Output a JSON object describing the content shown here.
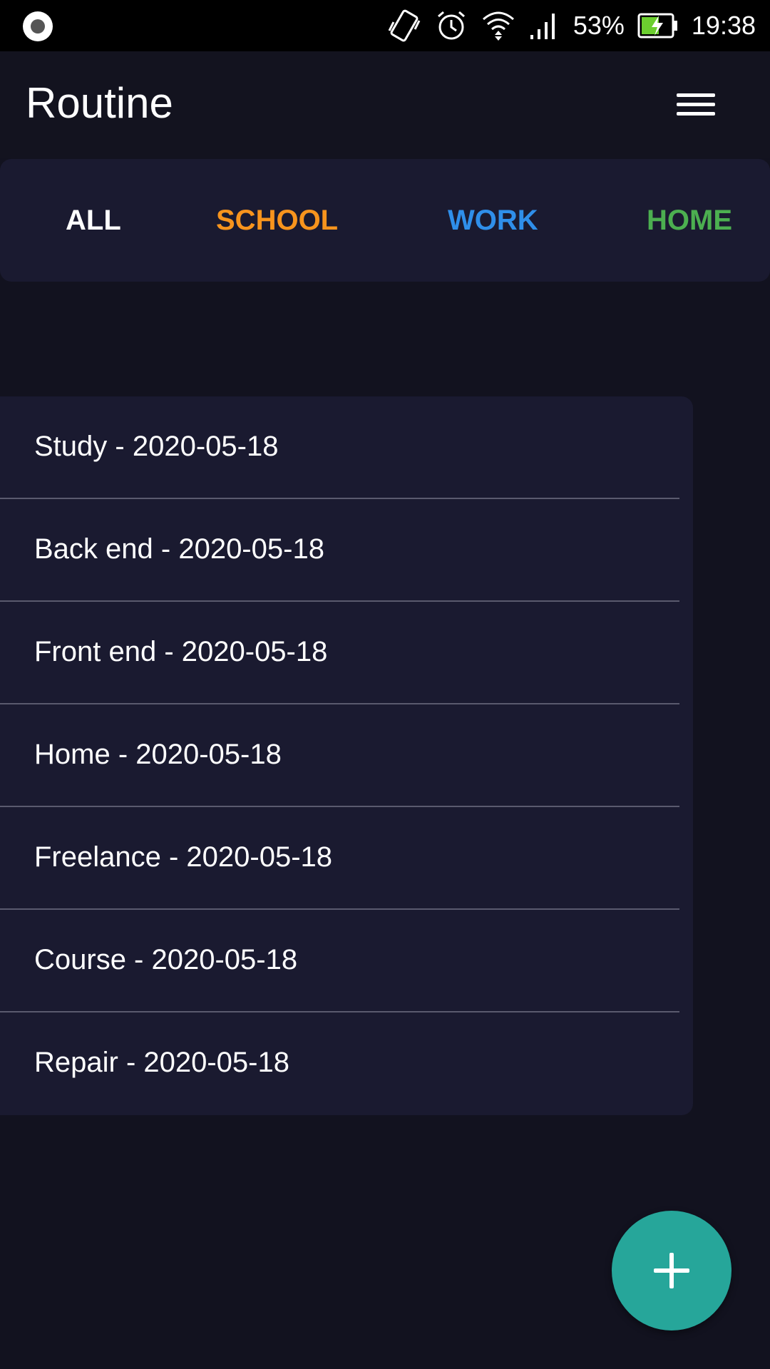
{
  "status_bar": {
    "icons": [
      "vibrate-icon",
      "alarm-icon",
      "wifi-icon",
      "signal-icon",
      "battery-charging-icon"
    ],
    "battery_percent": "53%",
    "time": "19:38"
  },
  "app_bar": {
    "title": "Routine",
    "menu_icon": "hamburger-menu-icon"
  },
  "tabs": [
    {
      "label": "ALL",
      "color": "#ffffff"
    },
    {
      "label": "SCHOOL",
      "color": "#f7941d"
    },
    {
      "label": "WORK",
      "color": "#2f8fea"
    },
    {
      "label": "HOME",
      "color": "#4caf50"
    }
  ],
  "routines": [
    {
      "label": "Study - 2020-05-18"
    },
    {
      "label": "Back end - 2020-05-18"
    },
    {
      "label": "Front end - 2020-05-18"
    },
    {
      "label": "Home - 2020-05-18"
    },
    {
      "label": "Freelance - 2020-05-18"
    },
    {
      "label": "Course - 2020-05-18"
    },
    {
      "label": "Repair - 2020-05-18"
    }
  ],
  "fab": {
    "icon": "plus-icon",
    "color": "#26a69a"
  }
}
